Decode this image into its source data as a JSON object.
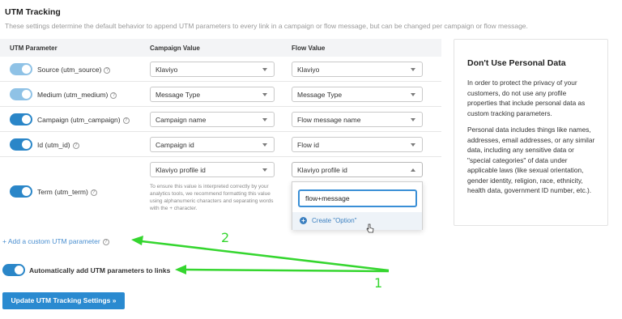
{
  "header": {
    "title": "UTM Tracking",
    "subtitle": "These settings determine the default behavior to append UTM parameters to every link in a campaign or flow message, but can be changed per campaign or flow message."
  },
  "table": {
    "columns": [
      "UTM Parameter",
      "Campaign Value",
      "Flow Value"
    ],
    "rows": [
      {
        "label": "Source (utm_source)",
        "campaign_value": "Klaviyo",
        "flow_value": "Klaviyo",
        "enabled": true
      },
      {
        "label": "Medium (utm_medium)",
        "campaign_value": "Message Type",
        "flow_value": "Message Type",
        "enabled": true
      },
      {
        "label": "Campaign (utm_campaign)",
        "campaign_value": "Campaign name",
        "flow_value": "Flow message name",
        "enabled": true
      },
      {
        "label": "Id (utm_id)",
        "campaign_value": "Campaign id",
        "flow_value": "Flow id",
        "enabled": true
      },
      {
        "label": "Term (utm_term)",
        "campaign_value": "Klaviyo profile id",
        "flow_value": "Klaviyo profile id",
        "enabled": true
      }
    ],
    "term_hint": "To ensure this value is interpreted correctly by your analytics tools, we recommend formatting this value using alphanumeric characters and separating words with the + character."
  },
  "dropdown": {
    "input_value": "flow+message",
    "create_option": "Create \"Option\""
  },
  "info_panel": {
    "title": "Don't Use Personal Data",
    "paragraph1": "In order to protect the privacy of your customers, do not use any profile properties that include personal data as custom tracking parameters.",
    "paragraph2": "Personal data includes things like names, addresses, email addresses, or any similar data, including any sensitive data or \"special categories\" of data under applicable laws (like sexual orientation, gender identity, religion, race, ethnicity, health data, government ID number, etc.)."
  },
  "add_custom_link": "+ Add a custom UTM parameter",
  "auto_add": {
    "label": "Automatically add UTM parameters to links",
    "enabled": true
  },
  "update_button": "Update UTM Tracking Settings »",
  "annotations": {
    "label_1": "1",
    "label_2": "2",
    "color": "#35d62f"
  },
  "colors": {
    "accent": "#2a86c8",
    "link": "#4a8fd0",
    "annotation": "#35d62f"
  }
}
